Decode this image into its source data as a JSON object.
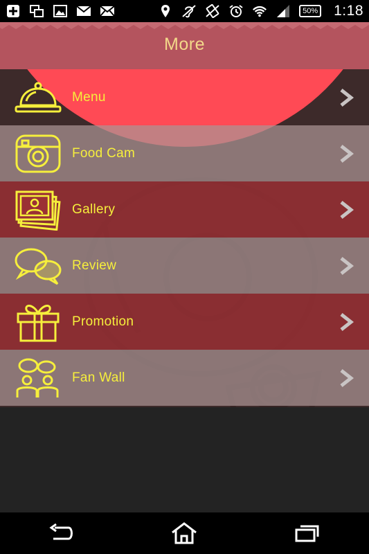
{
  "status_bar": {
    "battery": "50%",
    "time": "1:18",
    "left_icons": [
      "plus-notification-icon",
      "multi-window-icon",
      "image-icon",
      "gmail-icon",
      "mail-icon"
    ],
    "right_icons": [
      "location-icon",
      "hearing-aid-icon",
      "rotate-icon",
      "alarm-icon",
      "wifi-icon",
      "signal-icon"
    ]
  },
  "header": {
    "title": "More"
  },
  "menu": {
    "items": [
      {
        "label": "Menu",
        "icon": "cloche-icon"
      },
      {
        "label": "Food Cam",
        "icon": "camera-icon"
      },
      {
        "label": "Gallery",
        "icon": "photos-icon"
      },
      {
        "label": "Review",
        "icon": "chat-bubbles-icon"
      },
      {
        "label": "Promotion",
        "icon": "gift-icon"
      },
      {
        "label": "Fan Wall",
        "icon": "people-chat-icon"
      }
    ]
  },
  "colors": {
    "accent_text": "#f6ef3c",
    "header_bg": "#b4545e",
    "header_title": "#f3d98a",
    "row_dark": "#9b3034",
    "row_light": "#aa9494",
    "highlight_circle": "#ff4a55"
  },
  "nav_bar": {
    "buttons": [
      "back-icon",
      "home-icon",
      "recent-apps-icon"
    ]
  }
}
